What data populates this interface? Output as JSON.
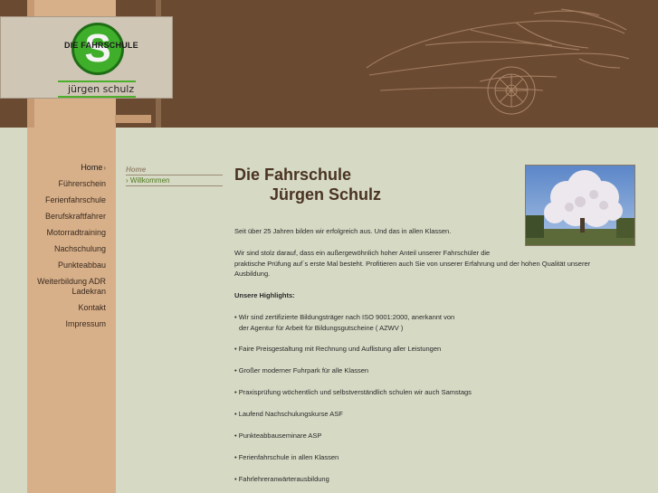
{
  "logo": {
    "title": "DIE FAHRSCHULE",
    "letter": "S",
    "name": "jürgen schulz"
  },
  "nav": {
    "items": [
      {
        "label": "Home"
      },
      {
        "label": "Führerschein"
      },
      {
        "label": "Ferienfahrschule"
      },
      {
        "label": "Berufskraftfahrer"
      },
      {
        "label": "Motorradtraining"
      },
      {
        "label": "Nachschulung"
      },
      {
        "label": "Punkteabbau"
      },
      {
        "label": "Weiterbildung ADR"
      },
      {
        "label": "Ladekran"
      },
      {
        "label": "Kontakt"
      },
      {
        "label": "Impressum"
      }
    ]
  },
  "breadcrumb": {
    "home": "Home",
    "current": "Willkommen"
  },
  "content": {
    "title_line1": "Die Fahrschule",
    "title_line2": "Jürgen Schulz",
    "intro": "Seit über 25 Jahren bilden wir erfolgreich aus. Und das in allen Klassen.",
    "pride_line1": "Wir sind stolz darauf, dass ein außergewöhnlich hoher Anteil unserer Fahrschüler die",
    "pride_line2": "praktische Prüfung auf´s erste Mal besteht. Profitieren auch Sie von unserer Erfahrung und der hohen Qualität unserer",
    "pride_line3": "Ausbildung.",
    "highlights_heading": "Unsere Highlights:",
    "h1_line1": "• Wir sind zertifizierte Bildungsträger nach ISO 9001:2000, anerkannt von",
    "h1_line2": "der Agentur für Arbeit für Bildungsgutscheine ( AZWV )",
    "h2": "• Faire Preisgestaltung mit Rechnung und Auflistung aller Leistungen",
    "h3": "• Großer moderner Fuhrpark für alle Klassen",
    "h4": "• Praxisprüfung wöchentlich und selbstverständlich schulen wir auch Samstags",
    "h5": "• Laufend Nachschulungskurse ASF",
    "h6": "• Punkteabbauseminare ASP",
    "h7": "• Ferienfahrschule in allen Klassen",
    "h8": "• Fahrlehreranwärterausbildung"
  },
  "colors": {
    "header_brown": "#6b4a32",
    "pillar_tan": "#d7b08a",
    "background": "#d6d9c4",
    "logo_green": "#3fae2a"
  }
}
